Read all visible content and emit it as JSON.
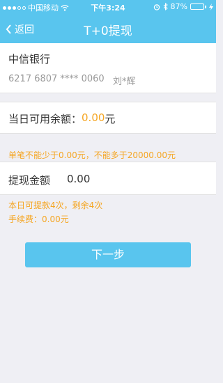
{
  "status_bar": {
    "carrier": "中国移动",
    "time": "下午3:24",
    "battery": "87%",
    "battery_level": 0.87,
    "icons": [
      "signal-dots",
      "wifi-icon",
      "alarm-icon",
      "bluetooth-icon",
      "battery-icon",
      "charging-icon"
    ]
  },
  "nav": {
    "back_label": "返回",
    "title": "T+0提现"
  },
  "bank": {
    "name": "中信银行",
    "card_number": "6217 6807 **** 0060",
    "holder": "刘*辉"
  },
  "balance": {
    "label": "当日可用余额：",
    "amount": "0.00",
    "unit": "元"
  },
  "limit_note": "单笔不能少于0.00元，不能多于20000.00元",
  "withdraw": {
    "label": "提现金额",
    "value": "0.00"
  },
  "info": {
    "times": "本日可提款4次，剩余4次",
    "fee": "手续费：0.00元"
  },
  "next_button": "下一步",
  "colors": {
    "primary": "#59c5ee",
    "accent": "#f5a623",
    "background": "#efeff4"
  }
}
